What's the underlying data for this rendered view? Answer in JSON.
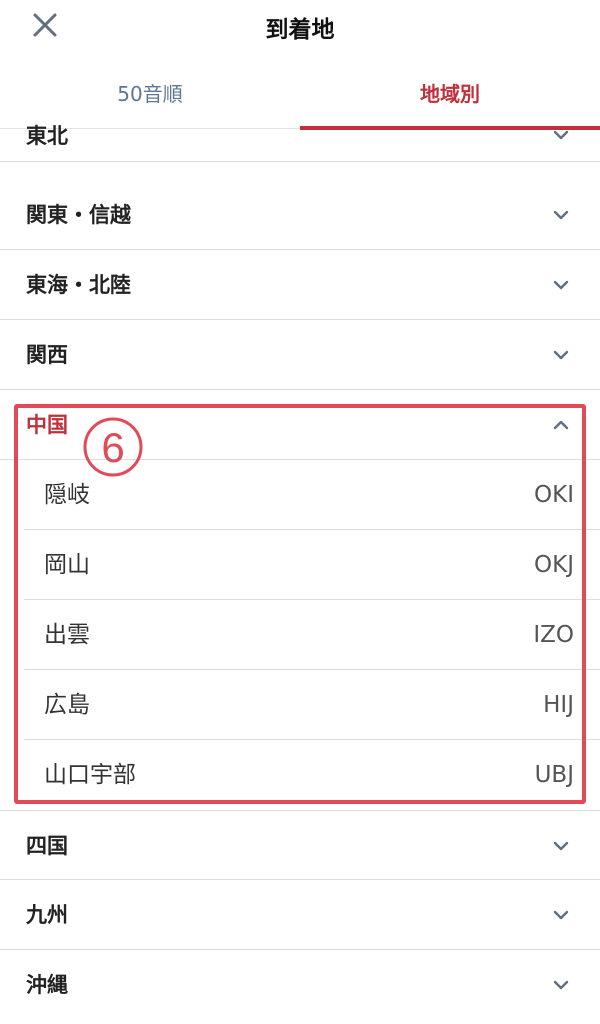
{
  "header": {
    "title": "到着地",
    "close_icon": "close-icon"
  },
  "tabs": [
    {
      "label": "50音順",
      "selected": false
    },
    {
      "label": "地域別",
      "selected": true
    }
  ],
  "regions": {
    "tohoku": "東北",
    "kanto": "関東・信越",
    "tokai": "東海・北陸",
    "kansai": "関西",
    "chugoku": "中国",
    "shikoku": "四国",
    "kyushu": "九州",
    "okinawa": "沖縄"
  },
  "chugoku_airports": [
    {
      "name": "隠岐",
      "code": "OKI"
    },
    {
      "name": "岡山",
      "code": "OKJ"
    },
    {
      "name": "出雲",
      "code": "IZO"
    },
    {
      "name": "広島",
      "code": "HIJ"
    },
    {
      "name": "山口宇部",
      "code": "UBJ"
    }
  ],
  "annotation": {
    "step": "6"
  },
  "colors": {
    "accent": "#c0303a",
    "highlight_box": "#e14a56",
    "tab_inactive": "#5d7894"
  }
}
